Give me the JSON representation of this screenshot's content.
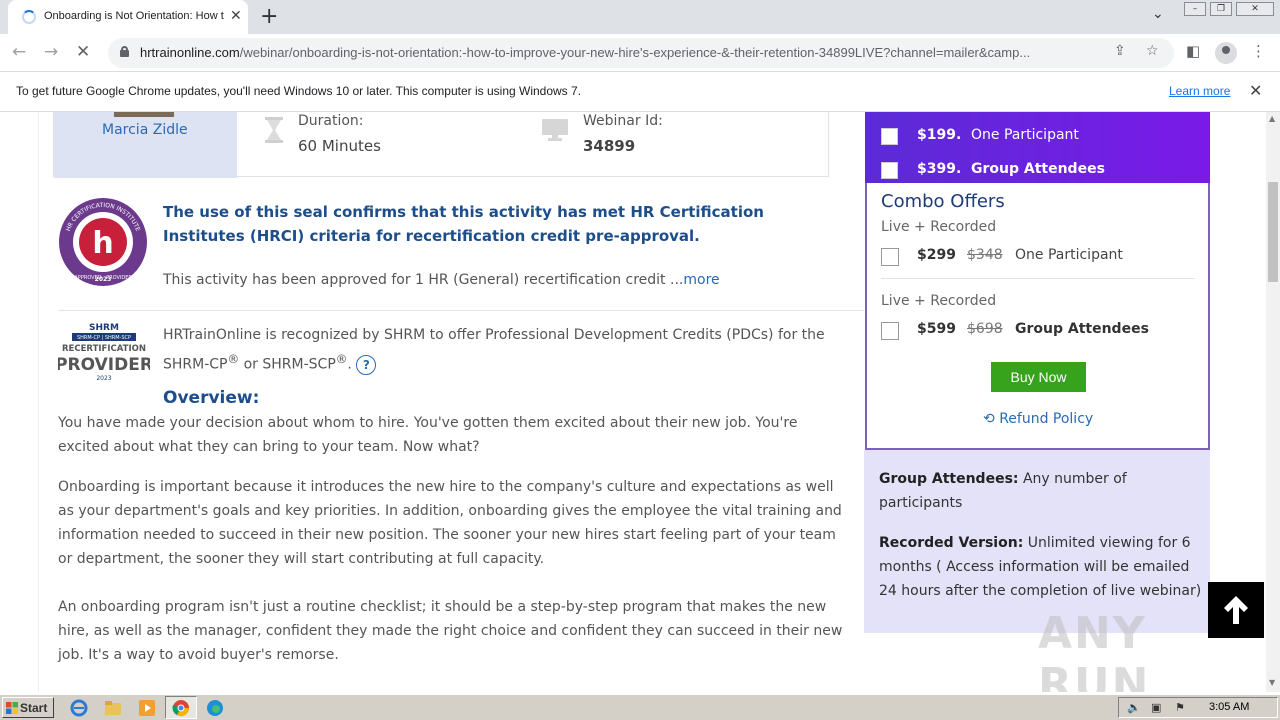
{
  "browser": {
    "tab_title": "Onboarding is Not Orientation: How to Improve Your New Hire's Experience",
    "url_host": "hrtrainonline.com",
    "url_path": "/webinar/onboarding-is-not-orientation:-how-to-improve-your-new-hire's-experience-&-their-retention-34899LIVE?channel=mailer&camp...",
    "infobar_text": "To get future Google Chrome updates, you'll need Windows 10 or later. This computer is using Windows 7.",
    "infobar_link": "Learn more"
  },
  "webinar": {
    "speaker_name": "Marcia Zidle",
    "duration_label": "Duration:",
    "duration_value": "60 Minutes",
    "webinar_id_label": "Webinar Id:",
    "webinar_id_value": "34899"
  },
  "hrci": {
    "seal_text": "HR CERTIFICATION INSTITUTE",
    "seal_letter": "h",
    "seal_approved": "APPROVED",
    "seal_year": "2023",
    "seal_provider": "PROVIDER",
    "headline": "The use of this seal confirms that this activity has met HR Certification Institutes (HRCI) criteria for recertification credit pre-approval.",
    "text": "This activity has been approved for 1 HR (General) recertification credit ...",
    "more_link": "more"
  },
  "shrm": {
    "logo_top": "SHRM",
    "logo_mid": "SHRM-CP | SHRM-SCP",
    "logo_recert": "RECERTIFICATION",
    "logo_provider": "PROVIDER",
    "logo_year": "2023",
    "text_part1": "HRTrainOnline is recognized by SHRM to offer Professional Development Credits (PDCs) for the SHRM-CP",
    "text_part2": " or SHRM-SCP",
    "text_part3": ". ",
    "registered": "®",
    "help": "?"
  },
  "overview": {
    "heading": "Overview:",
    "paragraphs": [
      "You have made your decision about whom to hire. You've gotten them excited about their new job. You're excited about what they can bring to your team. Now what?",
      "Onboarding is important because it introduces the new hire to the company's culture and expectations as well as your department's goals and key priorities. In addition, onboarding gives the employee the vital training and information needed to succeed in their new position. The sooner your new hires start feeling part of your team or department, the sooner they will start contributing at full capacity.",
      "An onboarding program isn't just a routine checklist; it should be a step-by-step program that makes the new hire, as well as the manager, confident they made the right choice and confident they can succeed in their new job. It's a way to avoid buyer's remorse."
    ]
  },
  "pricing": {
    "options": [
      {
        "price": "$199.",
        "label": "One Participant"
      },
      {
        "price": "$399.",
        "label": "Group Attendees"
      }
    ],
    "combo_title": "Combo Offers",
    "combos": [
      {
        "subtitle": "Live + Recorded",
        "price": "$299",
        "old_price": "$348",
        "label": "One Participant"
      },
      {
        "subtitle": "Live + Recorded",
        "price": "$599",
        "old_price": "$698",
        "label": "Group Attendees"
      }
    ],
    "buy_now": "Buy Now",
    "refund_policy": "Refund Policy",
    "notes": [
      {
        "title": "Group Attendees:",
        "text": " Any number of participants"
      },
      {
        "title": "Recorded Version:",
        "text": " Unlimited viewing for 6 months ( Access information will be emailed 24 hours after the completion of live webinar)"
      }
    ]
  },
  "watermark": "ANY RUN",
  "taskbar": {
    "start": "Start",
    "clock": "3:05 AM"
  },
  "colors": {
    "accent_purple": "#5b2bd6",
    "heading_blue": "#1c4e8c",
    "link_blue": "#2a6ab5",
    "buy_green": "#37a31c"
  }
}
